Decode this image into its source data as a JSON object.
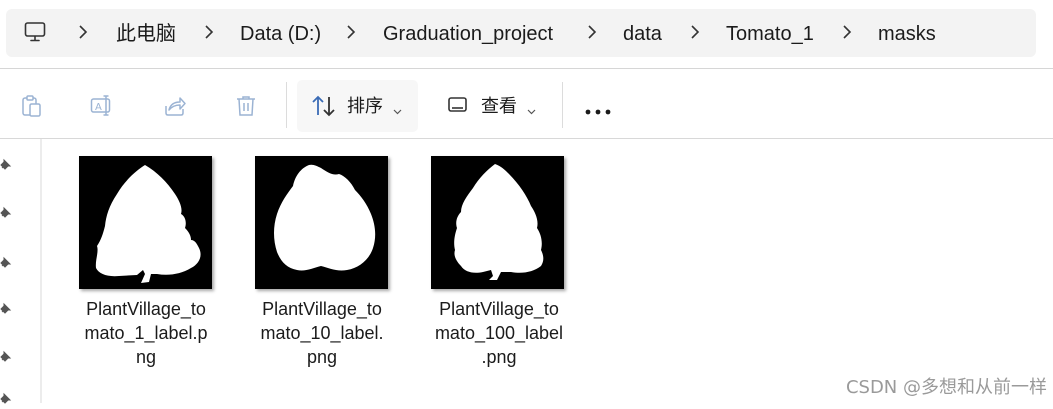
{
  "breadcrumb": {
    "items": [
      "此电脑",
      "Data (D:)",
      "Graduation_project",
      "data",
      "Tomato_1",
      "masks"
    ]
  },
  "toolbar": {
    "sort_label": "排序",
    "view_label": "查看",
    "icons": [
      "clipboard-icon",
      "rename-icon",
      "share-icon",
      "delete-icon",
      "sort-icon",
      "view-icon",
      "more-icon"
    ]
  },
  "files": [
    {
      "name_lines": [
        "PlantVillage_to",
        "mato_1_label.p",
        "ng"
      ]
    },
    {
      "name_lines": [
        "PlantVillage_to",
        "mato_10_label.",
        "png"
      ]
    },
    {
      "name_lines": [
        "PlantVillage_to",
        "mato_100_label",
        ".png"
      ]
    }
  ],
  "watermark": "CSDN @多想和从前一样",
  "colors": {
    "address_bg": "#f3f3f3",
    "sort_button_bg": "#f7f7f7",
    "icon_blue": "#3a6bb5",
    "icon_disabled": "#9bb3d3",
    "thumbnail_bg": "#000000",
    "mask_fill": "#ffffff"
  }
}
